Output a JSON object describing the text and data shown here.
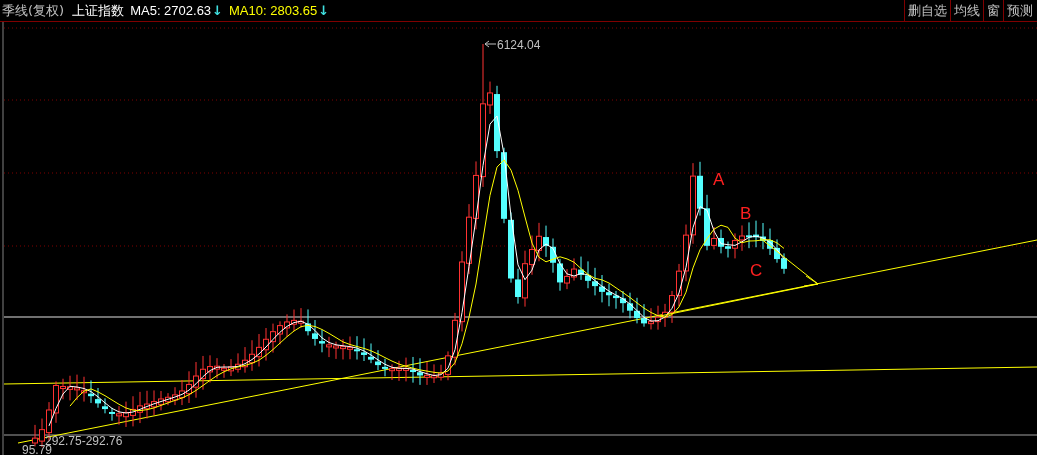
{
  "header": {
    "period": "季线(复权)",
    "index_name": "上证指数",
    "indicators": [
      {
        "label": "MA5: 2702.63",
        "arrow": "↓",
        "kind": "ma5"
      },
      {
        "label": "MA10: 2803.65",
        "arrow": "↓",
        "kind": "ma10"
      }
    ]
  },
  "buttons": [
    {
      "label": "删自选"
    },
    {
      "label": "均线"
    },
    {
      "label": "窗"
    },
    {
      "label": "预测"
    }
  ],
  "chart": {
    "high_label": "6124.04",
    "low_label": "292.75-292.76",
    "bottom_label": "95.79",
    "markers": [
      {
        "label": "A"
      },
      {
        "label": "B"
      },
      {
        "label": "C"
      }
    ]
  }
}
